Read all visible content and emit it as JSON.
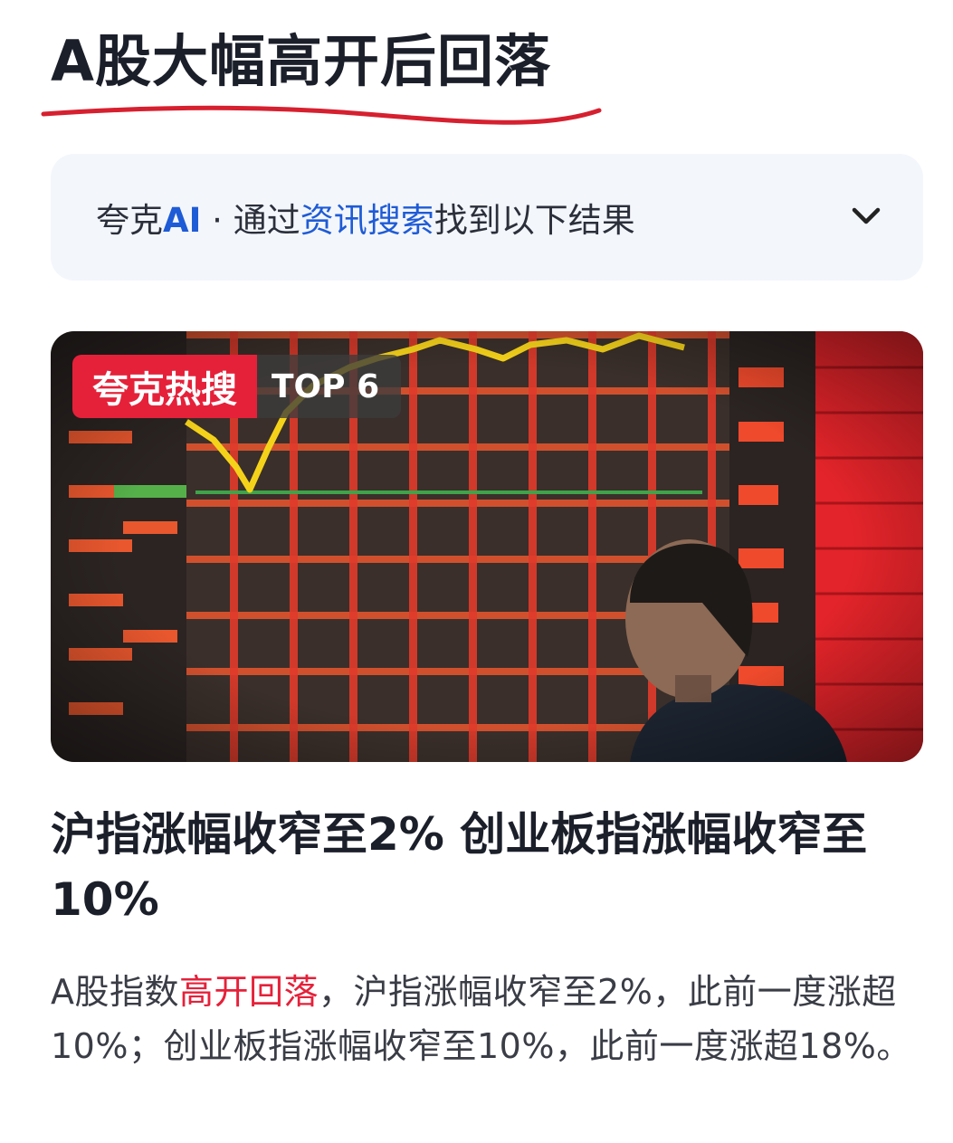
{
  "header": {
    "title": "A股大幅高开后回落"
  },
  "ai_bar": {
    "brand": "夸克",
    "brand_ai": "AI",
    "separator": " · ",
    "prefix": "通过",
    "link": "资讯搜索",
    "suffix": "找到以下结果",
    "toggle_icon": "chevron-down-icon"
  },
  "hot_badge": {
    "label": "夸克热搜",
    "rank": "TOP 6"
  },
  "article": {
    "title": "沪指涨幅收窄至2% 创业板指涨幅收窄至10%",
    "summary_prefix": "A股指数",
    "summary_highlight": "高开回落",
    "summary_rest": "，沪指涨幅收窄至2%，此前一度涨超10%；创业板指涨幅收窄至10%，此前一度涨超18%。"
  },
  "colors": {
    "accent_red": "#e5213a",
    "link_blue": "#1e5bd6"
  }
}
